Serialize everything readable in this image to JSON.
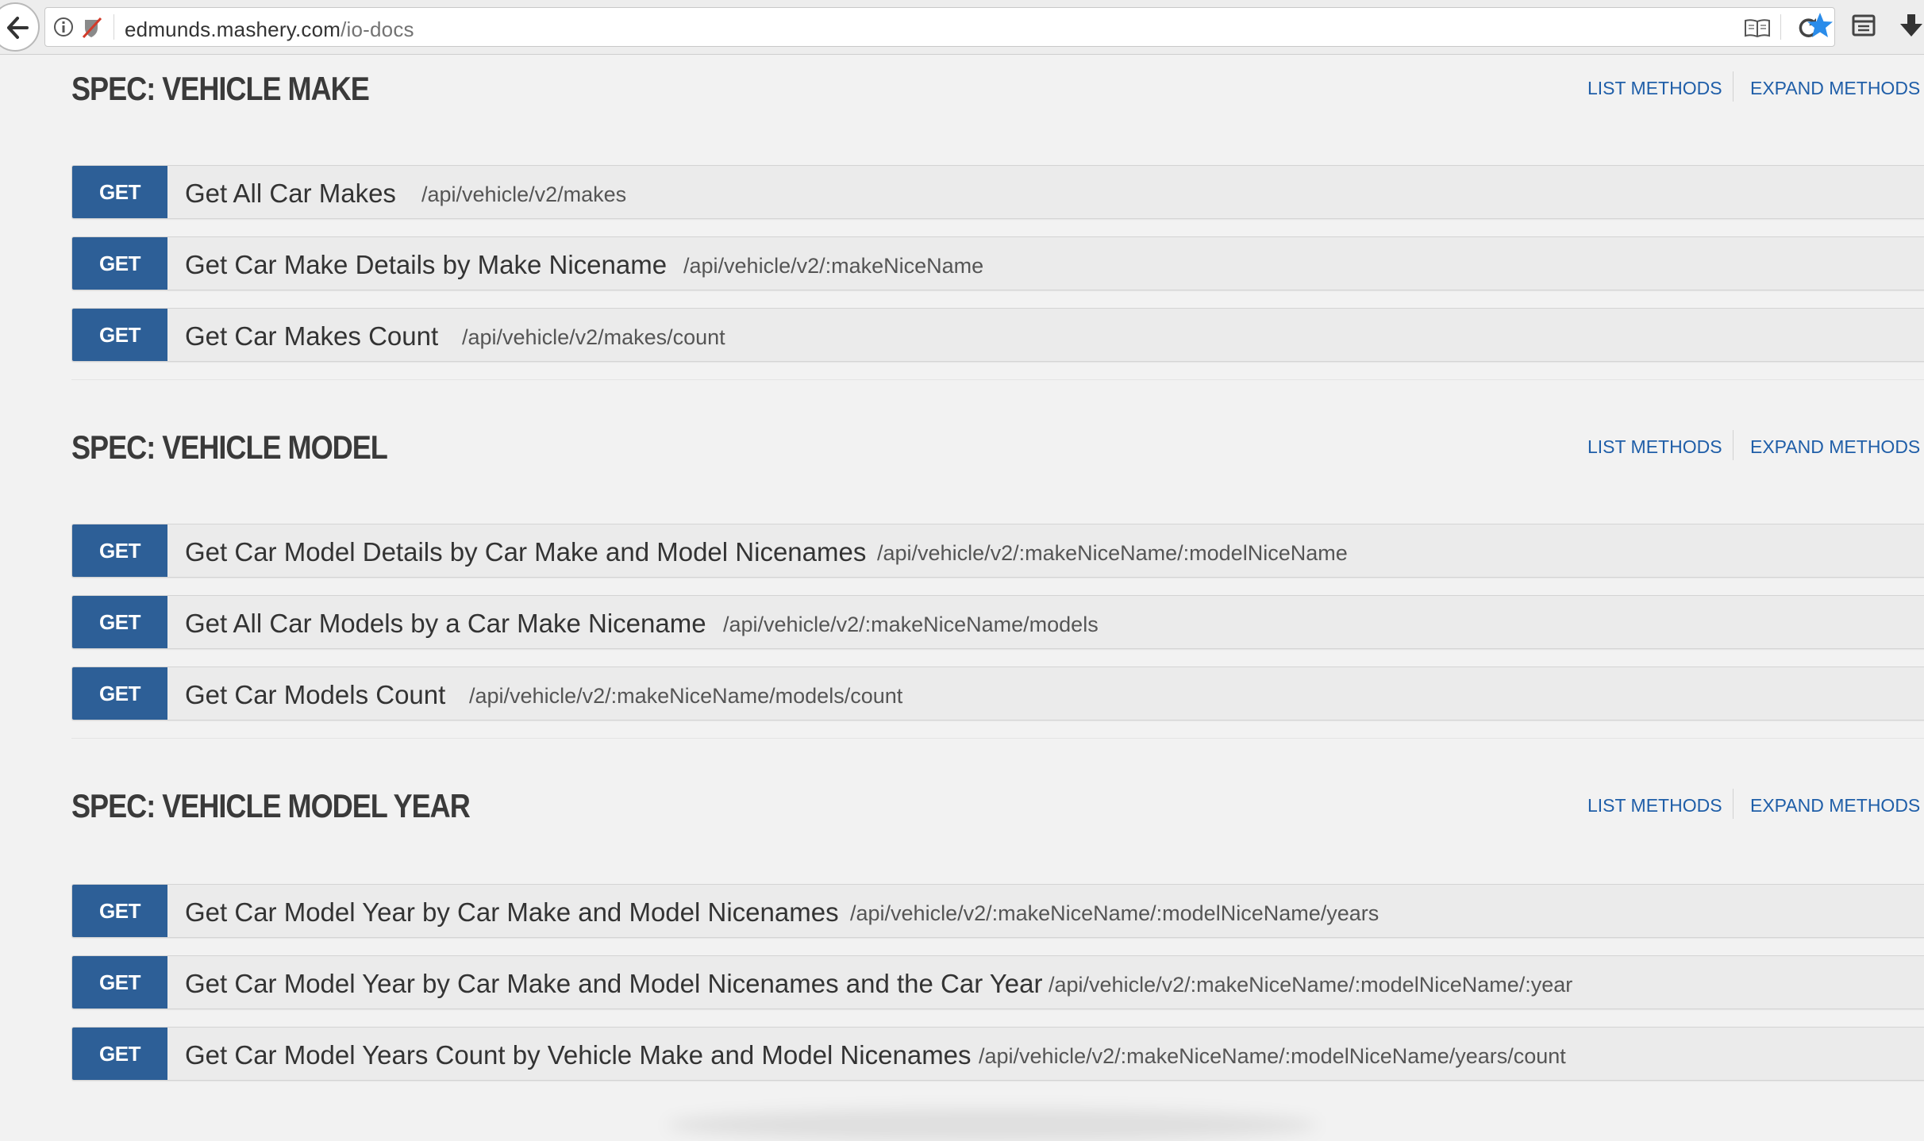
{
  "browser": {
    "url_domain_prefix": "edmunds.",
    "url_domain": "mashery.com",
    "url_path": "/io-docs"
  },
  "links": {
    "list_methods": "LIST METHODS",
    "expand_methods": "EXPAND METHODS"
  },
  "sections": [
    {
      "title": "SPEC: VEHICLE MAKE",
      "methods": [
        {
          "verb": "GET",
          "name": "Get All Car Makes",
          "path": "/api/vehicle/v2/makes"
        },
        {
          "verb": "GET",
          "name": "Get Car Make Details by Make Nicename",
          "path": "/api/vehicle/v2/:makeNiceName"
        },
        {
          "verb": "GET",
          "name": "Get Car Makes Count",
          "path": "/api/vehicle/v2/makes/count"
        }
      ]
    },
    {
      "title": "SPEC: VEHICLE MODEL",
      "methods": [
        {
          "verb": "GET",
          "name": "Get Car Model Details by Car Make and Model Nicenames",
          "path": "/api/vehicle/v2/:makeNiceName/:modelNiceName"
        },
        {
          "verb": "GET",
          "name": "Get All Car Models by a Car Make Nicename",
          "path": "/api/vehicle/v2/:makeNiceName/models"
        },
        {
          "verb": "GET",
          "name": "Get Car Models Count",
          "path": "/api/vehicle/v2/:makeNiceName/models/count"
        }
      ]
    },
    {
      "title": "SPEC: VEHICLE MODEL YEAR",
      "methods": [
        {
          "verb": "GET",
          "name": "Get Car Model Year by Car Make and Model Nicenames",
          "path": "/api/vehicle/v2/:makeNiceName/:modelNiceName/years"
        },
        {
          "verb": "GET",
          "name": "Get Car Model Year by Car Make and Model Nicenames and the Car Year",
          "path": "/api/vehicle/v2/:makeNiceName/:modelNiceName/:year"
        },
        {
          "verb": "GET",
          "name": "Get Car Model Years Count by Vehicle Make and Model Nicenames",
          "path": "/api/vehicle/v2/:makeNiceName/:modelNiceName/years/count"
        }
      ]
    }
  ],
  "colors": {
    "get_badge": "#2d5f97",
    "link": "#1f5ea8",
    "bookmark_star": "#2a8cea"
  },
  "icons": {
    "back": "back-arrow-icon",
    "info": "info-icon",
    "tracking": "tracking-protection-icon",
    "reader": "reader-view-icon",
    "reload": "reload-icon",
    "bookmark": "bookmark-star-icon",
    "library": "library-icon",
    "download": "download-icon"
  }
}
